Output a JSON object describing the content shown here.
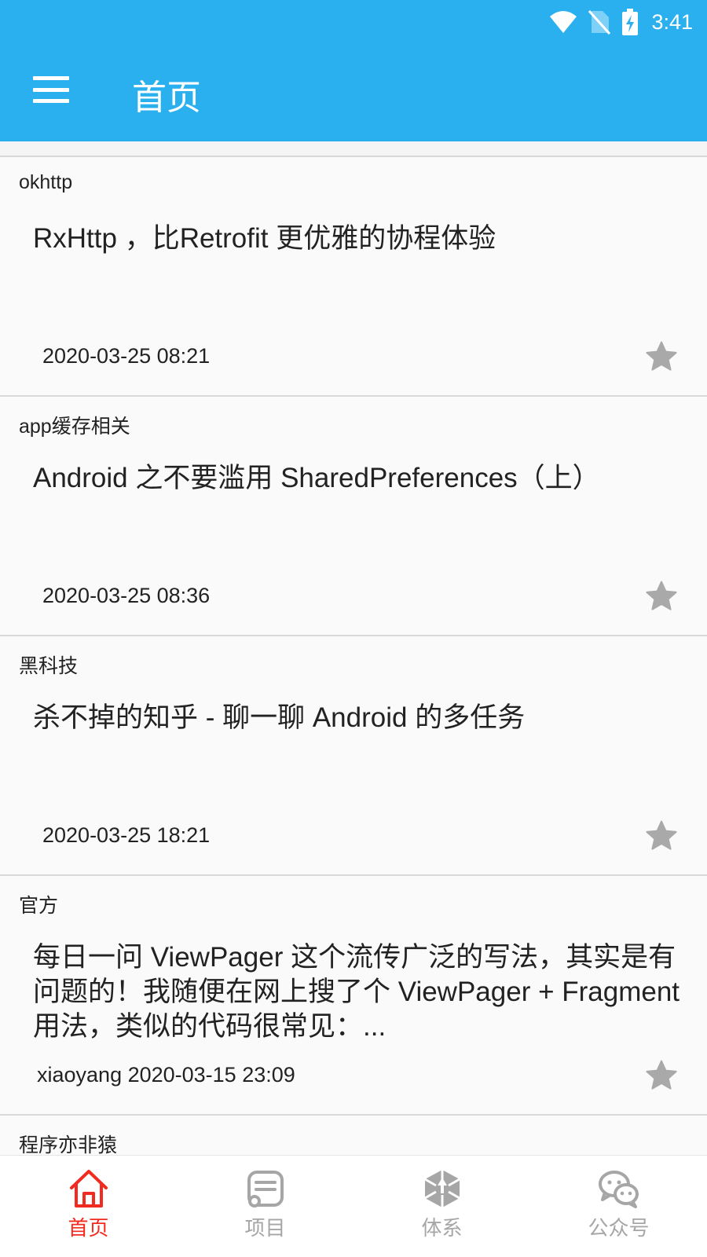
{
  "status_bar": {
    "time": "3:41",
    "icons": [
      "wifi-icon",
      "no-sim-icon",
      "battery-charging-icon"
    ]
  },
  "app_bar": {
    "title": "首页",
    "menu_icon": "menu-icon",
    "background": "#2bb0ef"
  },
  "articles": [
    {
      "category": "okhttp",
      "title": "RxHttp ，比Retrofit 更优雅的协程体验",
      "meta": "2020-03-25 08:21",
      "favorite_icon": "star-icon"
    },
    {
      "category": "app缓存相关",
      "title": "Android 之不要滥用 SharedPreferences（上）",
      "meta": "2020-03-25 08:36",
      "favorite_icon": "star-icon"
    },
    {
      "category": "黑科技",
      "title": "杀不掉的知乎 - 聊一聊 Android 的多任务",
      "meta": "2020-03-25 18:21",
      "favorite_icon": "star-icon"
    },
    {
      "category": "官方",
      "title": "每日一问 ViewPager 这个流传广泛的写法，其实是有问题的！我随便在网上搜了个 ViewPager + Fragment用法，类似的代码很常见：...",
      "meta": "xiaoyang 2020-03-15 23:09",
      "favorite_icon": "star-icon"
    },
    {
      "category": "程序亦非猿"
    }
  ],
  "bottom_nav": {
    "active_color": "#f22b20",
    "inactive_color": "#a6a6a6",
    "items": [
      {
        "label": "首页",
        "icon": "home-icon",
        "active": true
      },
      {
        "label": "项目",
        "icon": "project-icon",
        "active": false
      },
      {
        "label": "体系",
        "icon": "system-icon",
        "active": false
      },
      {
        "label": "公众号",
        "icon": "wechat-icon",
        "active": false
      }
    ]
  }
}
